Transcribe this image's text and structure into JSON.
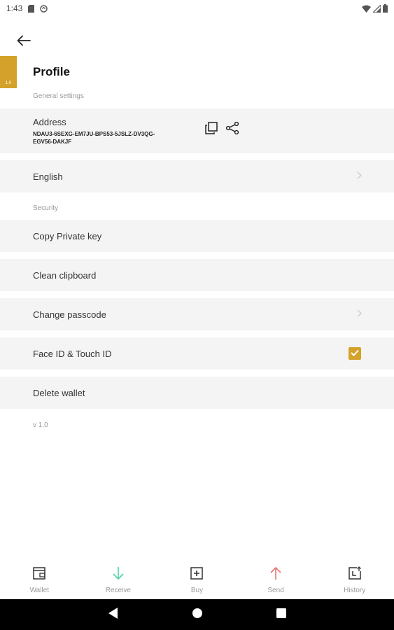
{
  "status_bar": {
    "time": "1:43"
  },
  "header": {
    "title": "Profile",
    "version_badge": "1.0"
  },
  "sections": {
    "general": "General settings",
    "security": "Security"
  },
  "address": {
    "label": "Address",
    "value": "NDAU3-6SEXG-EM7JU-BPS53-5JSLZ-DV3QG-EGV56-DAKJF"
  },
  "rows": {
    "language": "English",
    "copy_private_key": "Copy Private key",
    "clean_clipboard": "Clean clipboard",
    "change_passcode": "Change passcode",
    "face_touch_id": "Face ID & Touch ID",
    "delete_wallet": "Delete wallet"
  },
  "face_touch_id_enabled": true,
  "app_version": "v 1.0",
  "bottom_nav": {
    "wallet": "Wallet",
    "receive": "Receive",
    "buy": "Buy",
    "send": "Send",
    "history": "History"
  },
  "colors": {
    "accent": "#d4a12a",
    "receive": "#4ed3a0",
    "send": "#e8736f",
    "row_bg": "#f4f4f4"
  }
}
